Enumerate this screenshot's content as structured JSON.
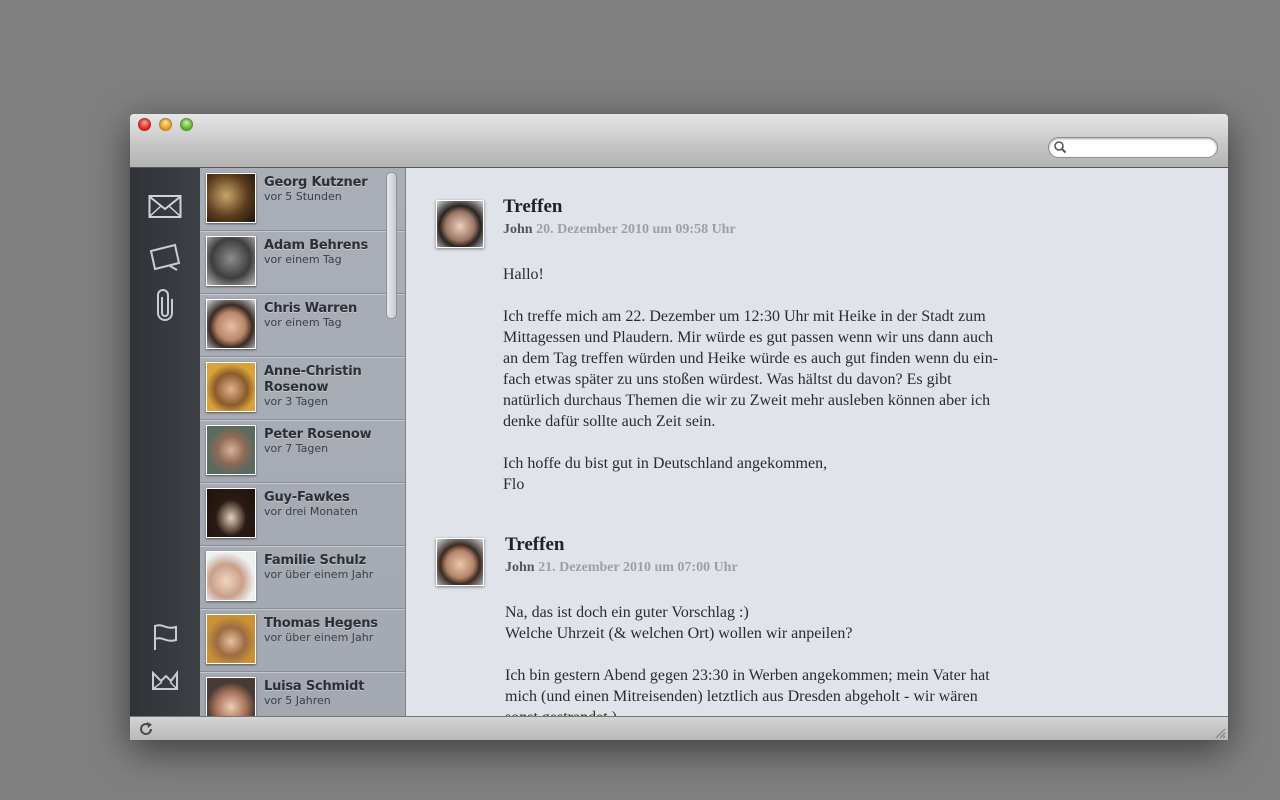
{
  "window": {
    "search_placeholder": ""
  },
  "sidebar_icons": [
    "mail-icon",
    "note-icon",
    "paperclip-icon",
    "flag-icon",
    "inbox-tray-icon"
  ],
  "contacts": [
    {
      "name": "Georg Kutzner",
      "time": "vor 5 Stunden"
    },
    {
      "name": "Adam Behrens",
      "time": "vor einem Tag"
    },
    {
      "name": "Chris Warren",
      "time": "vor einem Tag"
    },
    {
      "name": "Anne-Christin Rosenow",
      "time": "vor 3 Tagen"
    },
    {
      "name": "Peter Rosenow",
      "time": "vor 7 Tagen"
    },
    {
      "name": "Guy-Fawkes",
      "time": "vor drei Monaten"
    },
    {
      "name": "Familie Schulz",
      "time": "vor über einem Jahr"
    },
    {
      "name": "Thomas Hegens",
      "time": "vor über einem Jahr"
    },
    {
      "name": "Luisa Schmidt",
      "time": "vor 5 Jahren"
    }
  ],
  "messages": [
    {
      "subject": "Treffen",
      "from": "John",
      "date": "20. Dezember 2010 um 09:58 Uhr",
      "body": "Hallo!\n\nIch treffe mich am 22. Dezember um 12:30 Uhr mit Heike in der Stadt zum\nMittagessen und Plaudern. Mir würde es gut passen wenn wir uns dann auch\nan dem Tag treffen würden und Heike würde es auch gut finden wenn du ein-\nfach etwas später zu uns stoßen würdest. Was hältst du davon? Es gibt\nnatürlich durchaus Themen die wir zu Zweit mehr ausleben können aber ich\ndenke dafür sollte auch Zeit sein.\n\nIch hoffe du bist gut in Deutschland angekommen,\nFlo"
    },
    {
      "subject": "Treffen",
      "from": "John",
      "date": "21. Dezember 2010 um 07:00 Uhr",
      "body": "Na, das ist doch ein guter Vorschlag :)\nWelche Uhrzeit (& welchen Ort) wollen wir anpeilen?\n\nIch bin gestern Abend gegen 23:30 in Werben angekommen; mein Vater hat\nmich (und einen Mitreisenden) letztlich aus Dresden abgeholt - wir wären\nsonst gestrandet.)"
    }
  ]
}
